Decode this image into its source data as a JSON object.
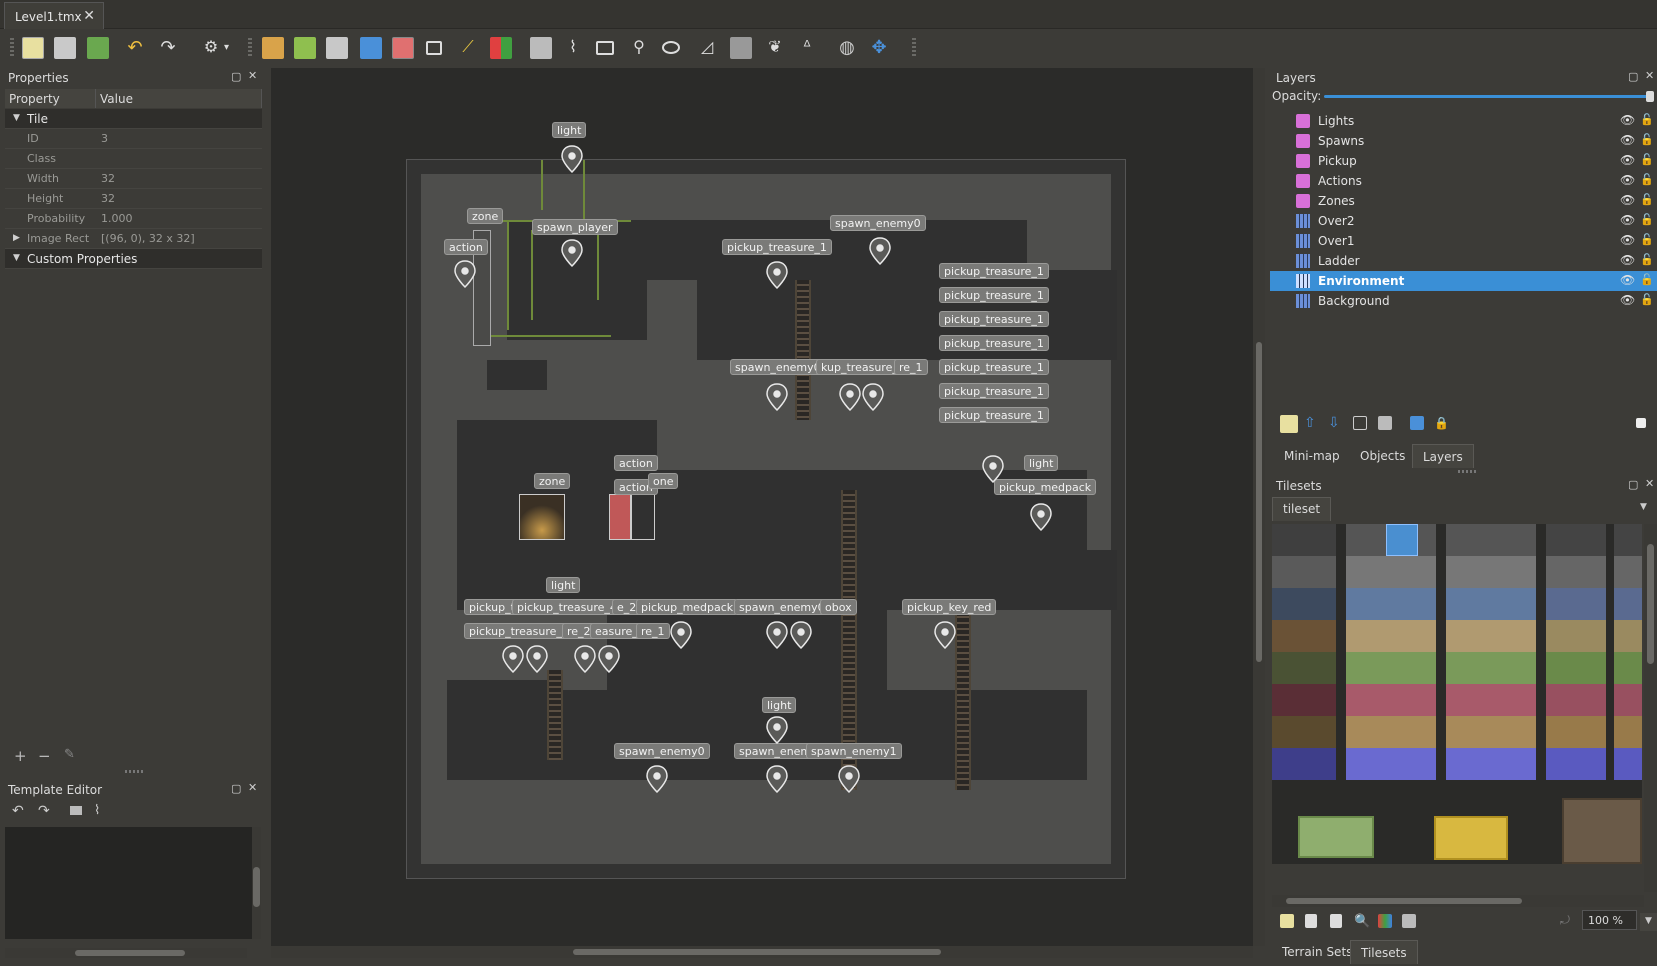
{
  "document_tab": {
    "title": "Level1.tmx",
    "close": "✕"
  },
  "properties": {
    "title": "Properties",
    "headers": {
      "property": "Property",
      "value": "Value"
    },
    "group_tile": "Tile",
    "rows": [
      {
        "key": "ID",
        "value": "3"
      },
      {
        "key": "Class",
        "value": ""
      },
      {
        "key": "Width",
        "value": "32"
      },
      {
        "key": "Height",
        "value": "32"
      },
      {
        "key": "Probability",
        "value": "1.000"
      },
      {
        "key": "Image Rect",
        "value": "[(96, 0), 32 x 32]"
      }
    ],
    "group_custom": "Custom Properties",
    "buttons": {
      "add": "+",
      "remove": "−",
      "edit": "✎"
    }
  },
  "template_editor": {
    "title": "Template Editor"
  },
  "map_objects": [
    {
      "label": "light"
    },
    {
      "label": "zone"
    },
    {
      "label": "spawn_player"
    },
    {
      "label": "action"
    },
    {
      "label": "pickup_treasure_1"
    },
    {
      "label": "spawn_enemy0"
    },
    {
      "label": "pickup_treasure_1"
    },
    {
      "label": "pickup_treasure_1"
    },
    {
      "label": "pickup_treasure_1"
    },
    {
      "label": "pickup_treasure_1"
    },
    {
      "label": "pickup_treasure_1"
    },
    {
      "label": "pickup_treasure_1"
    },
    {
      "label": "pickup_treasure_1"
    },
    {
      "label": "spawn_enemy0"
    },
    {
      "label": "kup_treasure_1"
    },
    {
      "label": "re_1"
    },
    {
      "label": "action"
    },
    {
      "label": "zone"
    },
    {
      "label": "action"
    },
    {
      "label": "one"
    },
    {
      "label": "light"
    },
    {
      "label": "pickup_medpack"
    },
    {
      "label": "light"
    },
    {
      "label": "pickup_t"
    },
    {
      "label": "pickup_treasure_4"
    },
    {
      "label": "e_2"
    },
    {
      "label": "pickup_medpack"
    },
    {
      "label": "spawn_enemy0"
    },
    {
      "label": "obox"
    },
    {
      "label": "pickup_key_red"
    },
    {
      "label": "pickup_treasure_1"
    },
    {
      "label": "re_2"
    },
    {
      "label": "easure_2"
    },
    {
      "label": "re_1"
    },
    {
      "label": "light"
    },
    {
      "label": "spawn_enemy0"
    },
    {
      "label": "spawn_enem"
    },
    {
      "label": "spawn_enemy1"
    }
  ],
  "layers": {
    "title": "Layers",
    "opacity_label": "Opacity:",
    "opacity": 1.0,
    "items": [
      {
        "name": "Lights",
        "kind": "object-layer-icon"
      },
      {
        "name": "Spawns",
        "kind": "object-layer-icon"
      },
      {
        "name": "Pickup",
        "kind": "object-layer-icon"
      },
      {
        "name": "Actions",
        "kind": "object-layer-icon"
      },
      {
        "name": "Zones",
        "kind": "object-layer-icon"
      },
      {
        "name": "Over2",
        "kind": "tile-layer-icon"
      },
      {
        "name": "Over1",
        "kind": "tile-layer-icon"
      },
      {
        "name": "Ladder",
        "kind": "tile-layer-icon"
      },
      {
        "name": "Environment",
        "kind": "tile-layer-icon",
        "selected": true
      },
      {
        "name": "Background",
        "kind": "tile-layer-icon"
      }
    ],
    "tabs": [
      "Mini-map",
      "Objects",
      "Layers"
    ],
    "active_tab": "Layers"
  },
  "tilesets": {
    "title": "Tilesets",
    "tab": "tileset",
    "zoom": "100 %",
    "bottom_tabs": [
      "Terrain Sets",
      "Tilesets"
    ],
    "active_bottom_tab": "Tilesets"
  },
  "colors": {
    "selection": "#3a8fd6",
    "object_layer": "#d870d8",
    "tile_layer": "#6b8fd8"
  }
}
